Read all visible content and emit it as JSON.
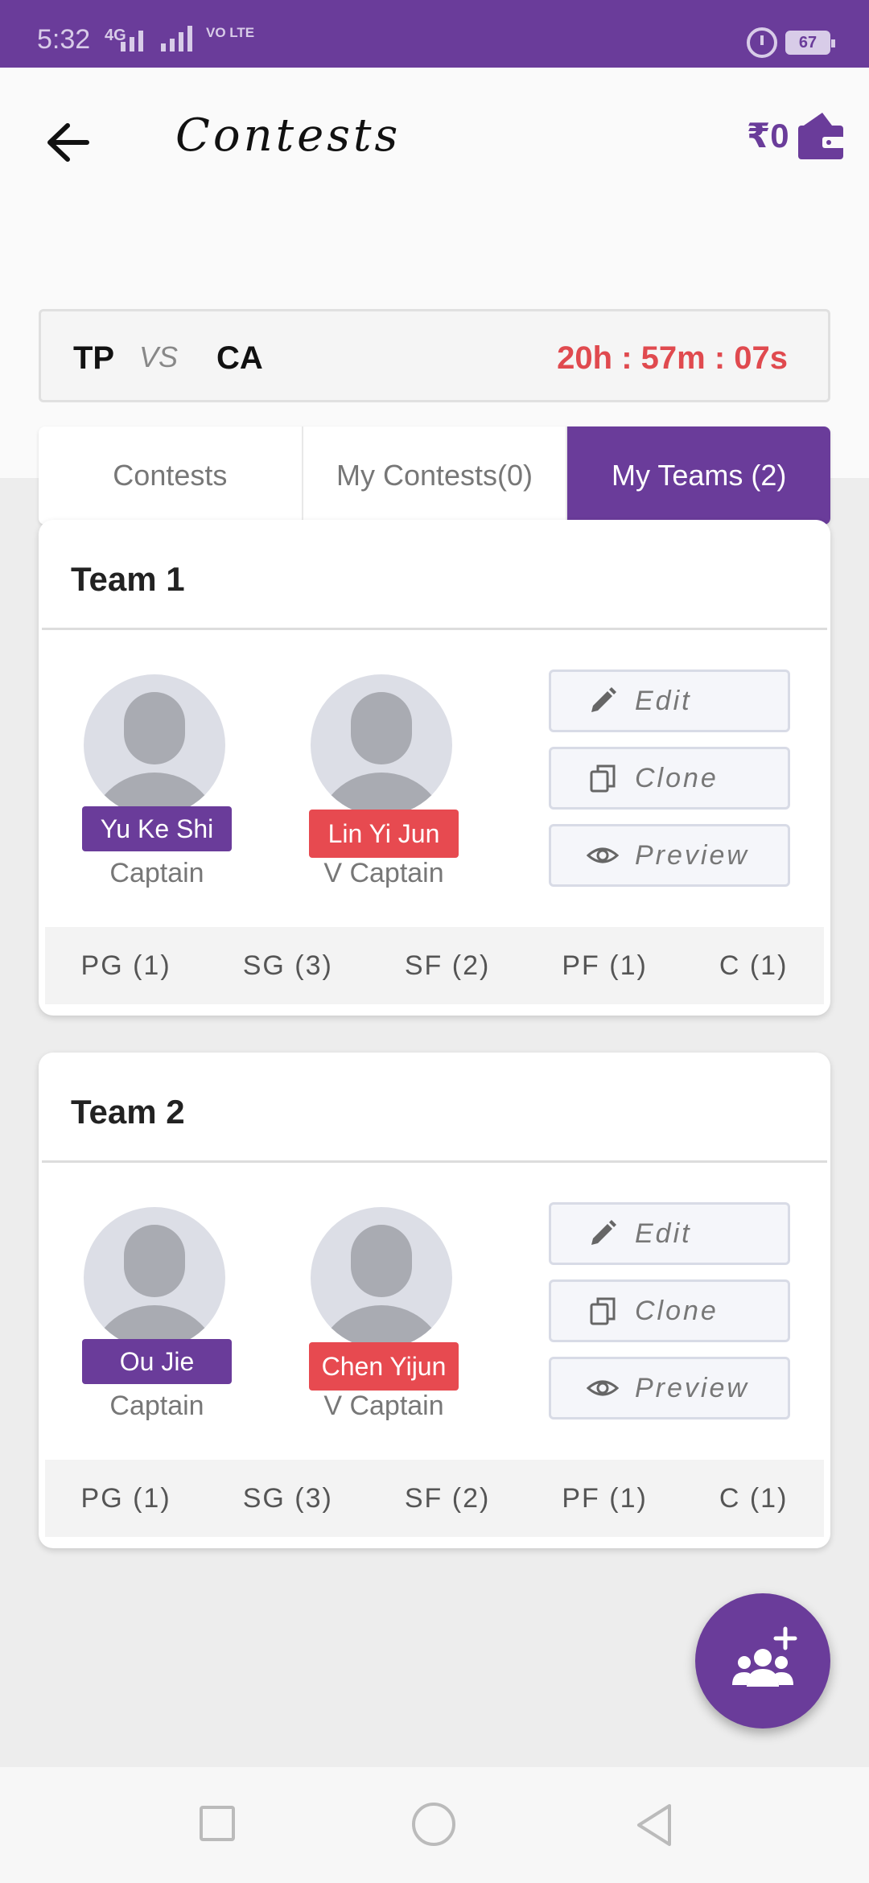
{
  "status_bar": {
    "time": "5:32",
    "network": "4G",
    "volte": "VO LTE",
    "battery": "67"
  },
  "header": {
    "title": "Contests",
    "wallet_amount": "₹0"
  },
  "match": {
    "team_a": "TP",
    "vs": "VS",
    "team_b": "CA",
    "countdown": "20h : 57m : 07s"
  },
  "tabs": [
    {
      "label": "Contests",
      "active": false
    },
    {
      "label": "My Contests(0)",
      "active": false
    },
    {
      "label": "My Teams (2)",
      "active": true
    }
  ],
  "teams": [
    {
      "name": "Team 1",
      "captain": {
        "name": "Yu Ke Shi",
        "role": "Captain"
      },
      "vice_captain": {
        "name": "Lin Yi Jun",
        "role": "V Captain"
      },
      "actions": {
        "edit": "Edit",
        "clone": "Clone",
        "preview": "Preview"
      },
      "positions": [
        "PG (1)",
        "SG (3)",
        "SF (2)",
        "PF (1)",
        "C (1)"
      ]
    },
    {
      "name": "Team 2",
      "captain": {
        "name": "Ou Jie",
        "role": "Captain"
      },
      "vice_captain": {
        "name": "Chen Yijun",
        "role": "V Captain"
      },
      "actions": {
        "edit": "Edit",
        "clone": "Clone",
        "preview": "Preview"
      },
      "positions": [
        "PG (1)",
        "SG (3)",
        "SF (2)",
        "PF (1)",
        "C (1)"
      ]
    }
  ],
  "colors": {
    "brand_purple": "#6a3c9a",
    "timer_red": "#e04a4f",
    "vice_captain_red": "#e74a50"
  },
  "icons": {
    "back": "arrow-left-icon",
    "wallet": "wallet-icon",
    "edit": "pencil-icon",
    "clone": "copy-icon",
    "preview": "eye-icon",
    "fab": "add-group-icon"
  }
}
